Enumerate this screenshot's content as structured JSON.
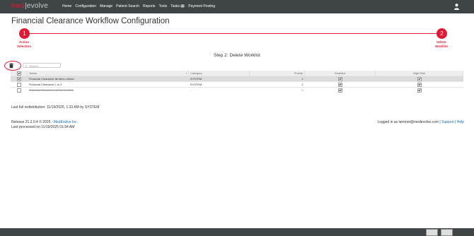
{
  "logo": {
    "part1": "med",
    "sep": "|",
    "part2": "evolve"
  },
  "nav": {
    "home": "Home",
    "configuration": "Configuration",
    "manage": "Manage",
    "patient_search": "Patient Search",
    "reports": "Reports",
    "tools": "Tools",
    "tasks": "Tasks",
    "tasks_count": "0",
    "payment_posting": "Payment Posting"
  },
  "page_title": "Financial Clearance Workflow Configuration",
  "steps": [
    {
      "number": "1",
      "label_line1": "Action",
      "label_line2": "Selection"
    },
    {
      "number": "2",
      "label_line1": "Delete",
      "label_line2": "Worklist"
    }
  ],
  "step_heading": "Step 2: Delete Worklist",
  "search": {
    "placeholder": "Search..."
  },
  "table": {
    "headers": {
      "name": "Name",
      "category": "Category",
      "priority": "Priority",
      "enabled": "Enabled",
      "high_risk": "High Risk"
    },
    "rows": [
      {
        "name": "Financial Clearance all demo clinics",
        "category": "SYSTEM",
        "priority": "1",
        "checked": true,
        "enabled": true,
        "high_risk": true
      },
      {
        "name": "Financial Clearance L to Z",
        "category": "SYSTEM",
        "priority": "2",
        "checked": false,
        "enabled": true,
        "high_risk": true
      },
      {
        "name": "Financial Clearance old demo clinic",
        "category": "-",
        "priority": "3",
        "checked": false,
        "enabled": true,
        "high_risk": true
      }
    ]
  },
  "last_full": "Last full redistribution: 11/19/2025, 1:33 AM by SYSTEM",
  "footer": {
    "release_prefix": "Release 21.2.0.4 © 2025 - ",
    "company": "MedEvolve Inc.",
    "last_processed": "Last processed on 11/19/2025 01:34 AM",
    "logged_in": "Logged in as lammot@medevolve.com | ",
    "support": "Support",
    "sep": " | ",
    "help": "Help"
  },
  "colors": {
    "accent": "#e31837",
    "nav_bg": "#3f4447"
  }
}
